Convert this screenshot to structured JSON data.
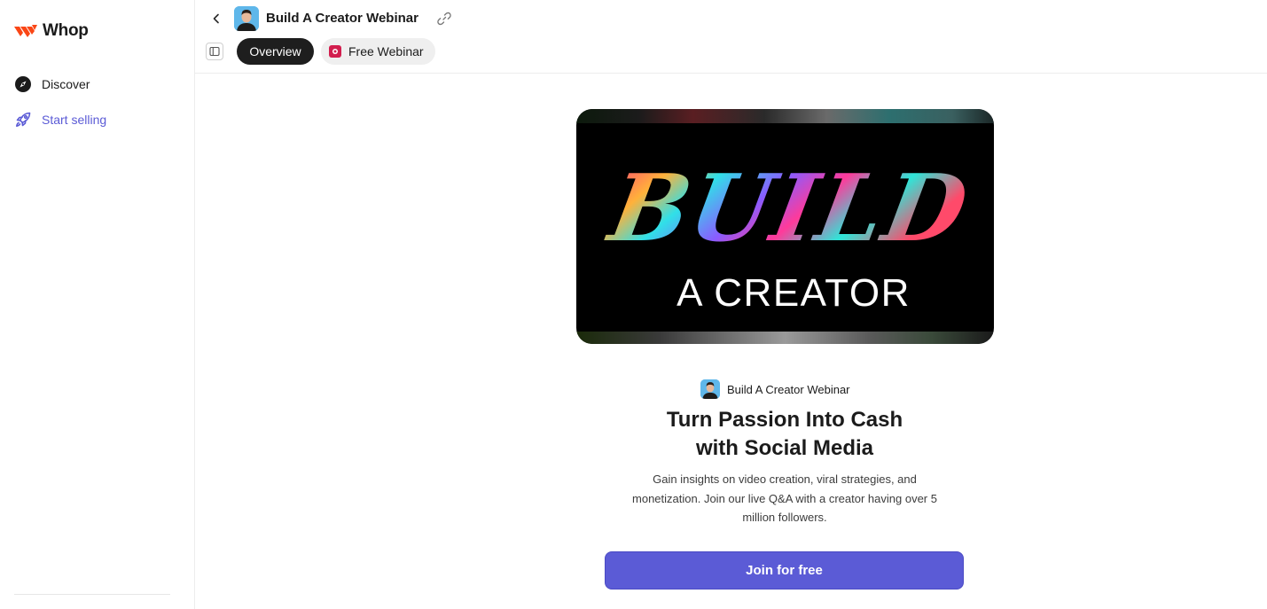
{
  "brand": {
    "name": "Whop",
    "accent": "#fa4616"
  },
  "sidebar": {
    "items": [
      {
        "label": "Discover",
        "icon": "compass-icon",
        "active": false
      },
      {
        "label": "Start selling",
        "icon": "rocket-icon",
        "active": true,
        "color": "#5b5bd6"
      }
    ]
  },
  "header": {
    "title": "Build A Creator Webinar",
    "tabs": [
      {
        "label": "Overview",
        "active": true
      },
      {
        "label": "Free Webinar",
        "active": false
      }
    ]
  },
  "banner": {
    "line1": "BUILD",
    "line2": "A CREATOR"
  },
  "product": {
    "name": "Build A Creator Webinar",
    "headline_line1": "Turn Passion Into Cash",
    "headline_line2": "with Social Media",
    "description": "Gain insights on video creation, viral strategies, and monetization. Join our live Q&A with a creator having over 5 million followers.",
    "cta_label": "Join for free",
    "cta_color": "#5b5bd6"
  }
}
